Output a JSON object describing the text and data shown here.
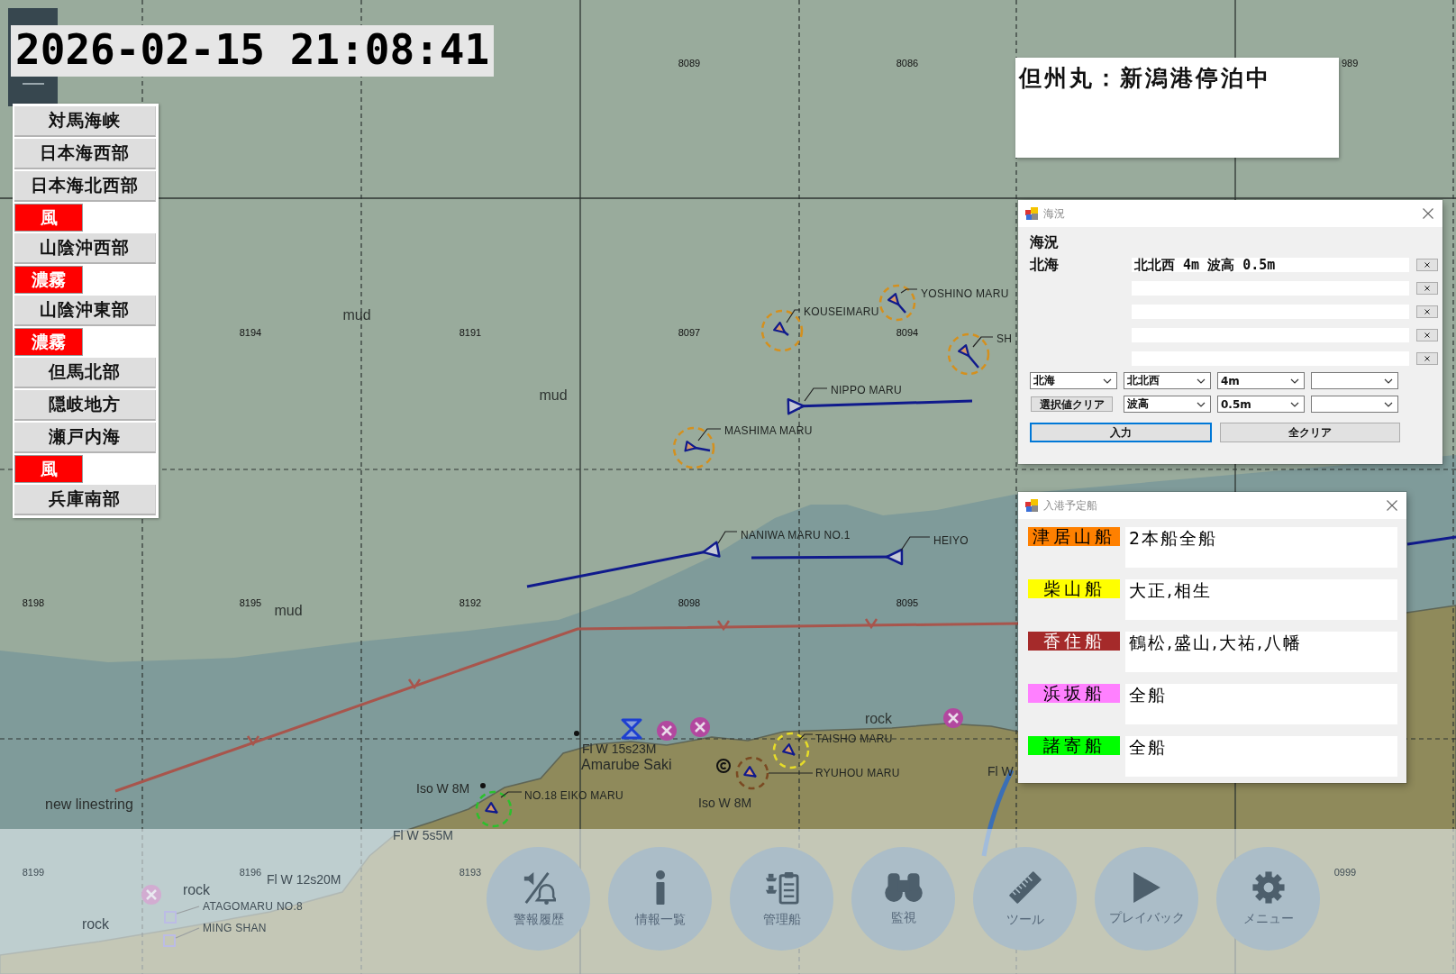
{
  "clock": "2026-02-15 21:08:41",
  "forecast_areas": [
    {
      "kind": "area",
      "label": "対馬海峡"
    },
    {
      "kind": "area",
      "label": "日本海西部"
    },
    {
      "kind": "area",
      "label": "日本海北西部"
    },
    {
      "kind": "warning",
      "label": "風"
    },
    {
      "kind": "area",
      "label": "山陰沖西部"
    },
    {
      "kind": "warning",
      "label": "濃霧"
    },
    {
      "kind": "area",
      "label": "山陰沖東部"
    },
    {
      "kind": "warning",
      "label": "濃霧"
    },
    {
      "kind": "area",
      "label": "但馬北部"
    },
    {
      "kind": "area",
      "label": "隠岐地方"
    },
    {
      "kind": "area",
      "label": "瀬戸内海"
    },
    {
      "kind": "warning",
      "label": "風"
    },
    {
      "kind": "area",
      "label": "兵庫南部"
    }
  ],
  "map": {
    "grid_numbers": [
      "8089",
      "8086",
      "989",
      "8194",
      "8191",
      "8097",
      "8094",
      "8198",
      "8195",
      "8192",
      "8098",
      "8095",
      "8199",
      "8196",
      "8193",
      "0999"
    ],
    "seabed_labels": [
      "mud",
      "mud",
      "mud",
      "rock",
      "rock",
      "rock"
    ],
    "light_labels": [
      "Fl W 15s23M",
      "Amarube Saki",
      "Iso W 8M",
      "Iso W 8M",
      "Fl W 5s5M",
      "Fl W 12s20M",
      "Fl W"
    ],
    "route": {
      "label": "new linestring"
    },
    "vessels": [
      {
        "name": "KOUSEIMARU",
        "kind": "ringed",
        "color": "#d4901e"
      },
      {
        "name": "YOSHINO MARU",
        "kind": "ringed",
        "color": "#d4901e"
      },
      {
        "name": "SH",
        "kind": "ringed",
        "color": "#d4901e"
      },
      {
        "name": "NIPPO MARU",
        "kind": "tracked"
      },
      {
        "name": "MASHIMA MARU",
        "kind": "ringed",
        "color": "#d4901e"
      },
      {
        "name": "NANIWA MARU NO.1",
        "kind": "tracked"
      },
      {
        "name": "HEIYO",
        "kind": "tracked"
      },
      {
        "name": "TAISHO MARU",
        "kind": "ringed",
        "color": "#e6dc28"
      },
      {
        "name": "RYUHOU MARU",
        "kind": "ringed",
        "color": "#7a4a22"
      },
      {
        "name": "NO.18 EIKO MARU",
        "kind": "ringed",
        "color": "#2cc02c"
      },
      {
        "name": "ATAGOMARU NO.8",
        "kind": "square"
      },
      {
        "name": "MING SHAN",
        "kind": "square"
      }
    ]
  },
  "status_box": {
    "text": "但州丸：新潟港停泊中"
  },
  "sea_dialog": {
    "title": "海況",
    "heading": "海況",
    "entries": [
      {
        "kind": "filled",
        "label": "北海",
        "value": "北北西 4m 波高 0.5m"
      },
      {
        "kind": "blank"
      },
      {
        "kind": "blank"
      },
      {
        "kind": "blank"
      },
      {
        "kind": "blank"
      }
    ],
    "selector_rows": [
      [
        {
          "kind": "select",
          "value": "北海"
        },
        {
          "kind": "select",
          "value": "北北西"
        },
        {
          "kind": "select",
          "value": "4m"
        },
        {
          "kind": "select"
        }
      ],
      [
        {
          "kind": "button",
          "label": "選択値クリア"
        },
        {
          "kind": "select",
          "value": "波高"
        },
        {
          "kind": "select",
          "value": "0.5m"
        },
        {
          "kind": "select"
        }
      ]
    ],
    "actions": [
      {
        "label": "入力",
        "focused": true
      },
      {
        "label": "全クリア",
        "focused": false
      }
    ]
  },
  "arrival_dialog": {
    "title": "入港予定船",
    "rows": [
      {
        "port": "津居山船",
        "color": "#ff8000",
        "ships": "2本船全船"
      },
      {
        "port": "柴山船",
        "color": "#ffff00",
        "ships": "大正,相生"
      },
      {
        "port": "香住船",
        "color": "#a52a2a",
        "ships": "鶴松,盛山,大祐,八幡"
      },
      {
        "port": "浜坂船",
        "color": "#ff80ff",
        "ships": "全船"
      },
      {
        "port": "諸寄船",
        "color": "#00ff00",
        "ships": "全船"
      }
    ]
  },
  "toolbar": [
    "警報履歴",
    "情報一覧",
    "管理船",
    "監視",
    "ツール",
    "プレイバック",
    "メニュー"
  ]
}
